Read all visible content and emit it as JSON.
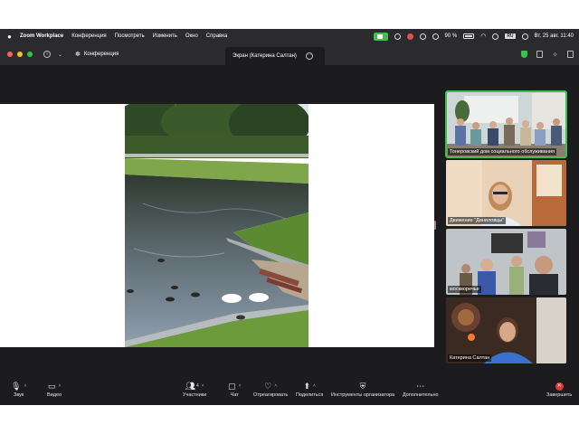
{
  "menubar": {
    "app_name": "Zoom Workplace",
    "items": [
      "Конференция",
      "Посмотреть",
      "Изменить",
      "Окно",
      "Справка"
    ],
    "battery": "90 %",
    "datetime": "Вт, 25 авг.  11:40"
  },
  "window": {
    "tabs": [
      {
        "label": "Конференция"
      },
      {
        "label": "Экран (Катерина Салтан)"
      }
    ]
  },
  "gallery": {
    "participants": [
      {
        "name": "Тонеровский дом социального обслуживания"
      },
      {
        "name": "Движение \"Даниловцы\""
      },
      {
        "name": "москворечье"
      },
      {
        "name": "Катерина Салтан"
      }
    ]
  },
  "toolbar": {
    "audio_label": "Звук",
    "video_label": "Видео",
    "participants_label": "Участники",
    "participants_count": "4",
    "chat_label": "Чат",
    "react_label": "Отреагировать",
    "share_label": "Поделиться",
    "host_tools_label": "Инструменты организатора",
    "more_label": "Дополнительно",
    "end_label": "Завершить"
  },
  "colors": {
    "accent_green": "#3fbf4f",
    "end_red": "#e03b3b",
    "window_bg": "#1c1c1e"
  }
}
